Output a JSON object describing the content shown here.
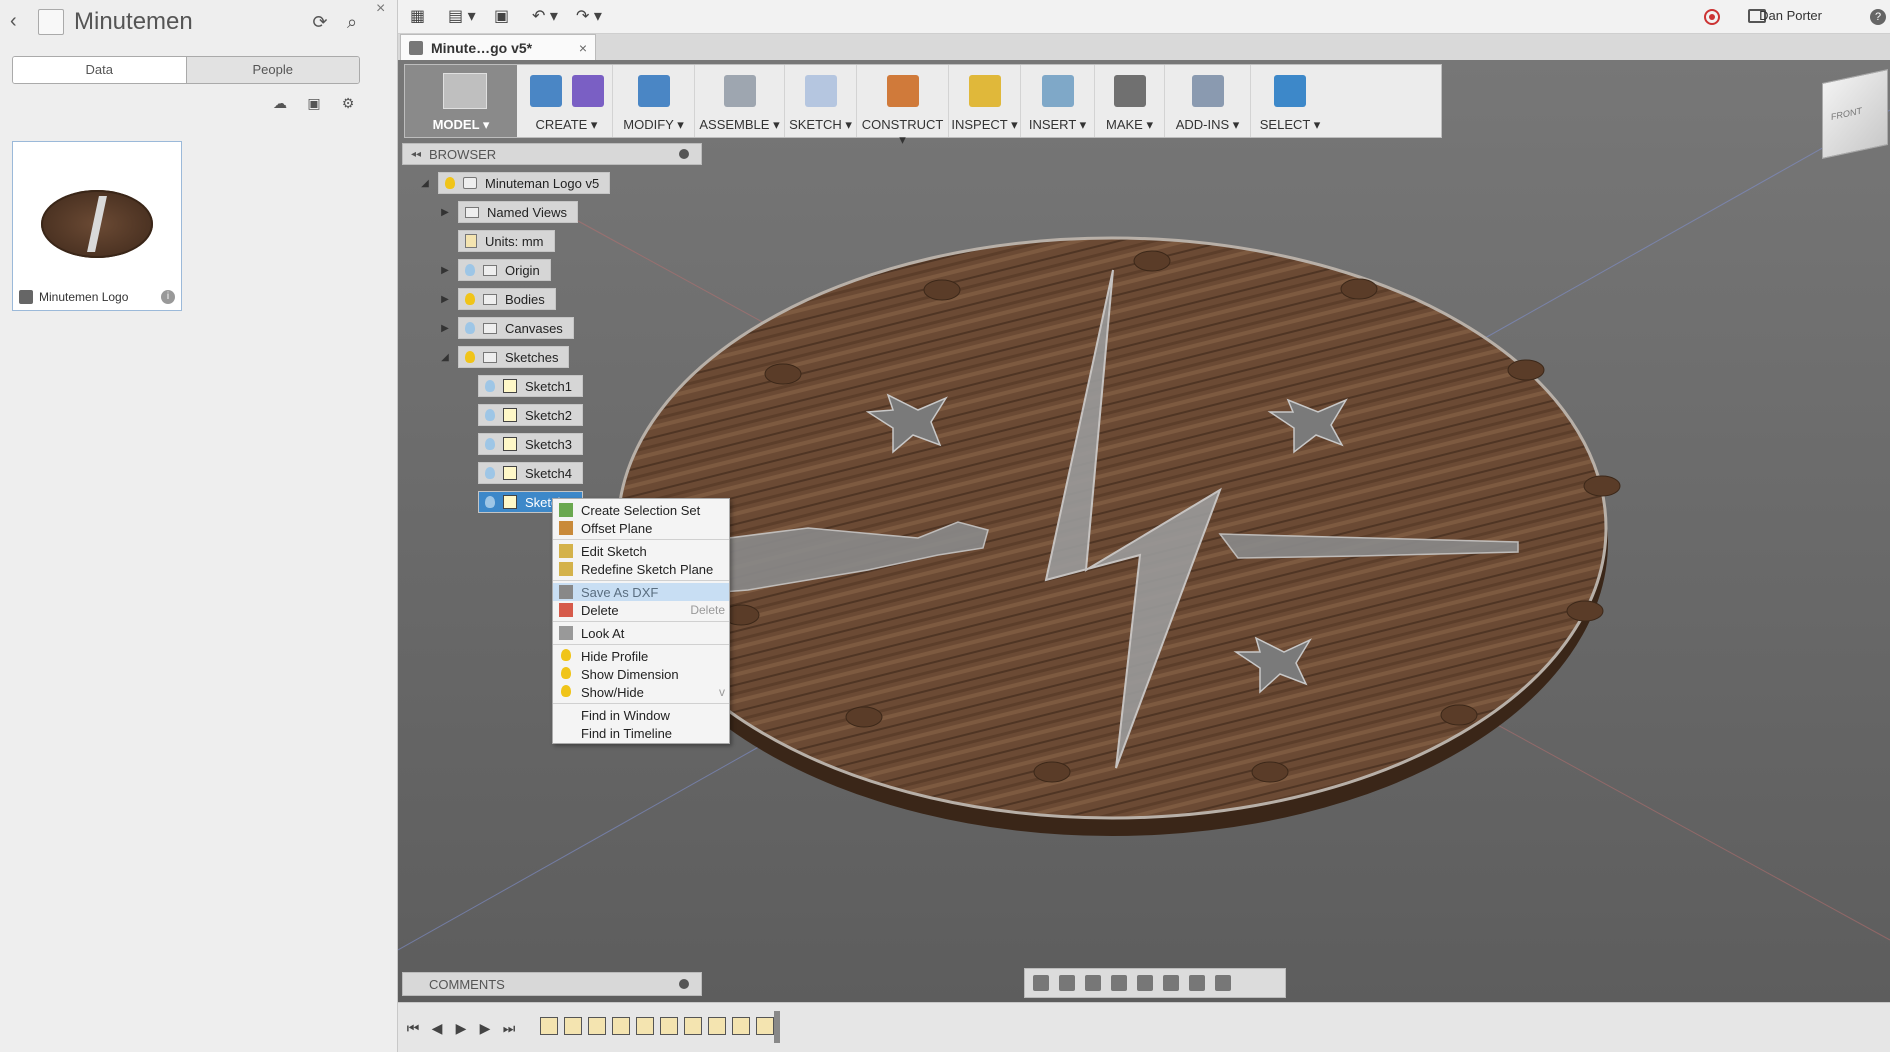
{
  "data_panel": {
    "project_title": "Minutemen",
    "tabs": [
      "Data",
      "People"
    ],
    "card": {
      "caption": "Minutemen Logo"
    }
  },
  "app_bar": {
    "user": "Dan Porter",
    "help": "?"
  },
  "doc_tab": {
    "label": "Minute…go v5*"
  },
  "toolbar": {
    "model": "MODEL ▾",
    "groups": [
      "CREATE ▾",
      "MODIFY ▾",
      "ASSEMBLE ▾",
      "SKETCH ▾",
      "CONSTRUCT ▾",
      "INSPECT ▾",
      "INSERT ▾",
      "MAKE ▾",
      "ADD-INS ▾",
      "SELECT ▾"
    ]
  },
  "browser": {
    "title": "BROWSER",
    "root": "Minuteman Logo v5",
    "named_views": "Named Views",
    "units": "Units: mm",
    "origin": "Origin",
    "bodies": "Bodies",
    "canvases": "Canvases",
    "sketches": "Sketches",
    "sketch_items": [
      "Sketch1",
      "Sketch2",
      "Sketch3",
      "Sketch4",
      "Sketch5"
    ]
  },
  "context_menu": {
    "items": [
      "Create Selection Set",
      "Offset Plane",
      "Edit Sketch",
      "Redefine Sketch Plane",
      "Save As DXF",
      "Delete",
      "Look At",
      "Hide Profile",
      "Show Dimension",
      "Show/Hide",
      "Find in Window",
      "Find in Timeline"
    ],
    "delete_shortcut": "Delete",
    "highlighted": "Save As DXF"
  },
  "comments": {
    "title": "COMMENTS"
  },
  "viewcube": {
    "label": "FRONT"
  },
  "colors": {
    "accent": "#3d88c9",
    "wood": "#6b4a34",
    "viewport": "#6a6a6a"
  }
}
